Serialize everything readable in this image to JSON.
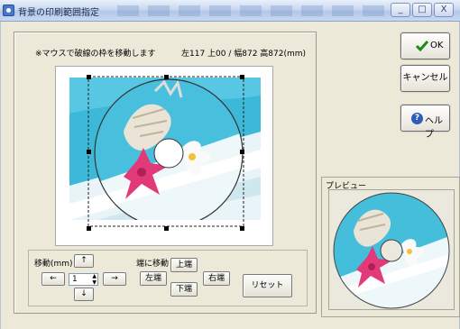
{
  "window": {
    "title": "背景の印刷範囲指定",
    "controls": [
      "_",
      "□",
      "X"
    ]
  },
  "editor": {
    "hint": "※マウスで破線の枠を移動します",
    "coords": "左117 上00 / 幅872 高872(mm)"
  },
  "move": {
    "label": "移動(mm)",
    "up": "↑",
    "down": "↓",
    "left": "←",
    "right": "→",
    "step_value": "1"
  },
  "edge": {
    "label": "端に移動",
    "top": "上端",
    "left": "左端",
    "bottom": "下端",
    "right": "右端"
  },
  "reset_label": "リセット",
  "buttons": {
    "ok": "OK",
    "cancel": "キャンセル",
    "help": "ヘルプ"
  },
  "preview": {
    "label": "プレビュー"
  },
  "icons": {
    "ok": "checkmark-icon",
    "help": "help-question-icon",
    "app": "app-icon",
    "spin": "spin-arrows-icon"
  },
  "colors": {
    "ok_check": "#1a8a1a",
    "help_circle": "#2d5db8",
    "water": "#3cb8d8",
    "flower": "#e23a78"
  }
}
